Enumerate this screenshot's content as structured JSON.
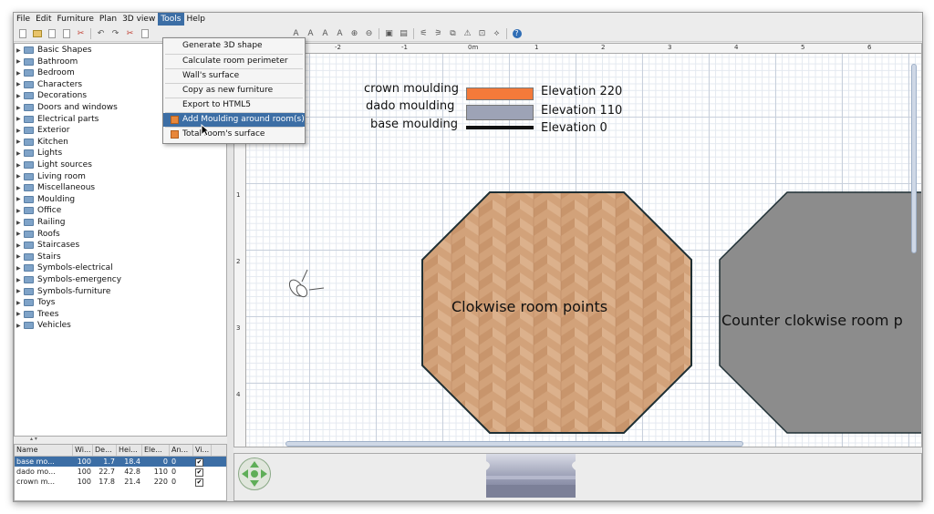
{
  "menubar": {
    "items": [
      "File",
      "Edit",
      "Furniture",
      "Plan",
      "3D view",
      "Tools",
      "Help"
    ],
    "active": "Tools"
  },
  "tools_menu": {
    "items": [
      "Generate 3D shape",
      "Calculate room perimeter",
      "Wall's surface",
      "Copy as new furniture",
      "Export to HTML5",
      "Add Moulding around room(s)",
      "Total room's surface"
    ],
    "highlighted": "Add Moulding around room(s)"
  },
  "catalog": {
    "categories": [
      "Basic Shapes",
      "Bathroom",
      "Bedroom",
      "Characters",
      "Decorations",
      "Doors and windows",
      "Electrical parts",
      "Exterior",
      "Kitchen",
      "Lights",
      "Light sources",
      "Living room",
      "Miscellaneous",
      "Moulding",
      "Office",
      "Railing",
      "Roofs",
      "Staircases",
      "Stairs",
      "Symbols-electrical",
      "Symbols-emergency",
      "Symbols-furniture",
      "Toys",
      "Trees",
      "Vehicles"
    ]
  },
  "furniture_table": {
    "headers": [
      "Name",
      "Wi...",
      "De...",
      "Hei...",
      "Ele...",
      "An...",
      "Vi..."
    ],
    "rows": [
      {
        "name": "base mo...",
        "width": "100",
        "depth": "1.7",
        "height": "18.4",
        "elevation": "0",
        "angle": "0",
        "visible": "✔",
        "selected": true
      },
      {
        "name": "dado mo...",
        "width": "100",
        "depth": "22.7",
        "height": "42.8",
        "elevation": "110",
        "angle": "0",
        "visible": "✔",
        "selected": false
      },
      {
        "name": "crown m...",
        "width": "100",
        "depth": "17.8",
        "height": "21.4",
        "elevation": "220",
        "angle": "0",
        "visible": "✔",
        "selected": false
      }
    ]
  },
  "plan": {
    "ruler_top": [
      "-2",
      "-1",
      "0m",
      "1",
      "2",
      "3",
      "4",
      "5",
      "6"
    ],
    "ruler_left": [
      "1",
      "2",
      "3",
      "4"
    ],
    "legend": [
      {
        "label": "crown moulding",
        "elevation": "Elevation 220",
        "color": "#f47a3a"
      },
      {
        "label": "dado moulding",
        "elevation": "Elevation 110",
        "color": "#9da3b6"
      },
      {
        "label": "base moulding",
        "elevation": "Elevation 0",
        "color": "#111111"
      }
    ],
    "room1_label": "Clokwise room points",
    "room2_label": "Counter clokwise room p",
    "floor_color": "#d2a27a",
    "room2_color": "#8c8c8c"
  }
}
